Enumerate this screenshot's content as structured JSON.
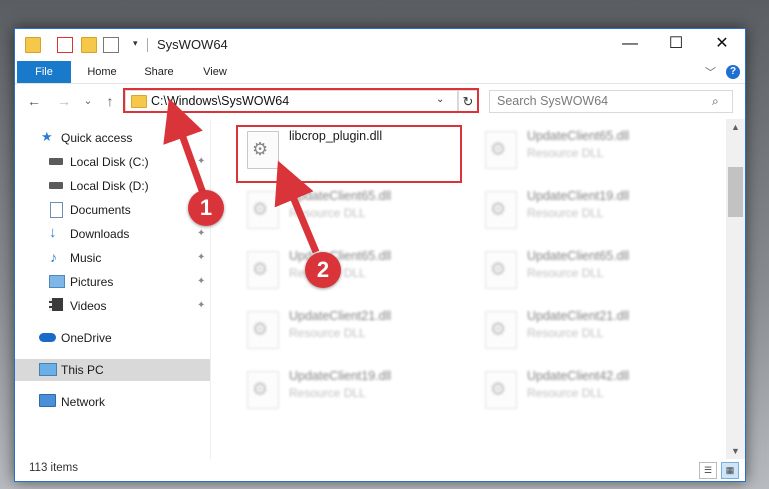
{
  "window": {
    "title": "SysWOW64",
    "minimize": "—",
    "maximize": "☐",
    "close": "✕"
  },
  "ribbon": {
    "tabs": [
      "File",
      "Home",
      "Share",
      "View"
    ],
    "help": "?",
    "collapse": "﹀"
  },
  "nav": {
    "back": "←",
    "forward": "→",
    "recent": "⌄",
    "up": "↑",
    "address": "C:\\Windows\\SysWOW64",
    "address_dropdown": "⌄",
    "refresh": "↻",
    "search_placeholder": "Search SysWOW64",
    "search_icon": "⌕"
  },
  "sidebar": {
    "items": [
      {
        "label": "Quick access",
        "icon": "star-icon",
        "pinned": false
      },
      {
        "label": "Local Disk (C:)",
        "icon": "drive-icon",
        "pinned": true
      },
      {
        "label": "Local Disk (D:)",
        "icon": "drive-icon",
        "pinned": false
      },
      {
        "label": "Documents",
        "icon": "documents-icon",
        "pinned": false
      },
      {
        "label": "Downloads",
        "icon": "download-icon",
        "pinned": true
      },
      {
        "label": "Music",
        "icon": "music-icon",
        "pinned": true
      },
      {
        "label": "Pictures",
        "icon": "pictures-icon",
        "pinned": true
      },
      {
        "label": "Videos",
        "icon": "videos-icon",
        "pinned": true
      },
      {
        "label": "OneDrive",
        "icon": "cloud-icon",
        "pinned": false
      },
      {
        "label": "This PC",
        "icon": "computer-icon",
        "pinned": false,
        "selected": true
      },
      {
        "label": "Network",
        "icon": "network-icon",
        "pinned": false
      }
    ],
    "pin_glyph": "✦"
  },
  "files": [
    {
      "name": "libcrop_plugin.dll",
      "type": "",
      "highlighted": true
    },
    {
      "name": "UpdateClient65.dll",
      "type": "Resource DLL"
    },
    {
      "name": "UpdateClient65.dll",
      "type": "Resource DLL"
    },
    {
      "name": "UpdateClient19.dll",
      "type": "Resource DLL"
    },
    {
      "name": "UpdateClient65.dll",
      "type": "Resource DLL"
    },
    {
      "name": "UpdateClient65.dll",
      "type": "Resource DLL"
    },
    {
      "name": "UpdateClient21.dll",
      "type": "Resource DLL"
    },
    {
      "name": "UpdateClient21.dll",
      "type": "Resource DLL"
    },
    {
      "name": "UpdateClient19.dll",
      "type": "Resource DLL"
    },
    {
      "name": "UpdateClient42.dll",
      "type": "Resource DLL"
    }
  ],
  "file_icon_glyph": "⚙",
  "status": {
    "item_count": "113 items",
    "details_view": "☰",
    "tiles_view": "▦"
  },
  "callouts": {
    "one": "1",
    "two": "2"
  },
  "colors": {
    "accent": "#1979ca",
    "callout": "#d9343a",
    "folder": "#f5c84a"
  }
}
